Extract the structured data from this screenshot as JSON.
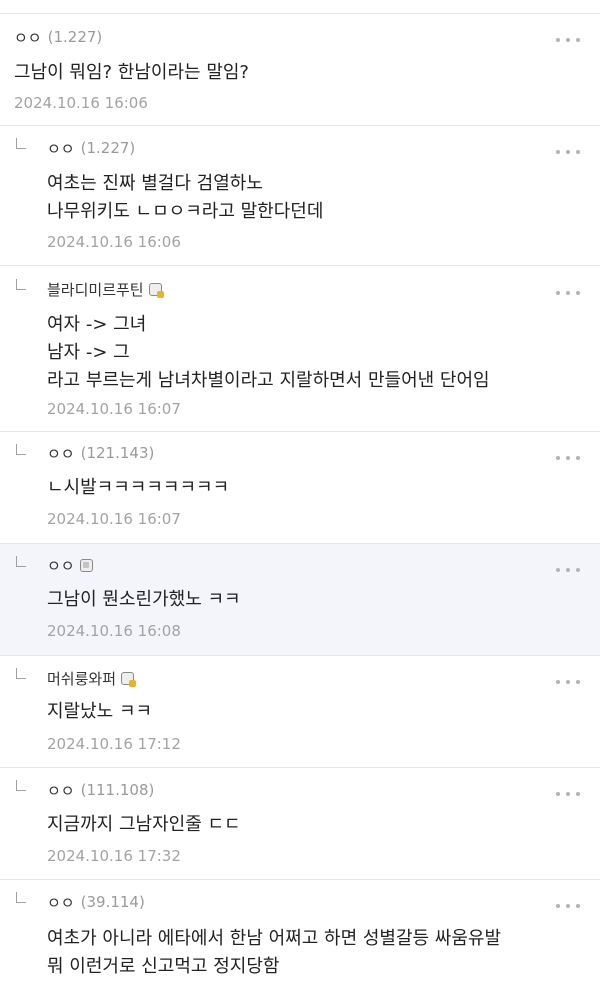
{
  "comments": [
    {
      "nick": "ㅇㅇ",
      "ip": "(1.227)",
      "lines": [
        "그남이 뭐임? 한남이라는 말임?"
      ],
      "date": "2024.10.16 16:06"
    },
    {
      "nick": "ㅇㅇ",
      "ip": "(1.227)",
      "lines": [
        "여초는 진짜 별걸다 검열하노",
        "나무위키도 ㄴㅁㅇㅋ라고 말한다던데"
      ],
      "date": "2024.10.16 16:06"
    },
    {
      "nick": "블라디미르푸틴",
      "ip": "",
      "lines": [
        "여자 -> 그녀",
        "남자 -> 그",
        "라고 부르는게 남녀차별이라고 지랄하면서 만들어낸 단어임"
      ],
      "date": "2024.10.16 16:07"
    },
    {
      "nick": "ㅇㅇ",
      "ip": "(121.143)",
      "lines": [
        "ㄴ시발ㅋㅋㅋㅋㅋㅋㅋㅋ"
      ],
      "date": "2024.10.16 16:07"
    },
    {
      "nick": "ㅇㅇ",
      "ip": "",
      "lines": [
        "그남이 뭔소린가했노 ㅋㅋ"
      ],
      "date": "2024.10.16 16:08"
    },
    {
      "nick": "머쉬룽와퍼",
      "ip": "",
      "lines": [
        "지랄났노 ㅋㅋ"
      ],
      "date": "2024.10.16 17:12"
    },
    {
      "nick": "ㅇㅇ",
      "ip": "(111.108)",
      "lines": [
        "지금까지 그남자인줄 ㄷㄷ"
      ],
      "date": "2024.10.16 17:32"
    },
    {
      "nick": "ㅇㅇ",
      "ip": "(39.114)",
      "lines": [
        "여초가 아니라 에타에서 한남 어쩌고 하면 성별갈등 싸움유발",
        "뭐 이런거로 신고먹고 정지당함"
      ],
      "date": ""
    }
  ],
  "icons": {
    "more": "more-options-icon",
    "reply": "reply-arrow-icon",
    "gallery_member": "gallery-member-icon",
    "gold_badge": "fixed-nick-badge-icon",
    "grey_badge": "semi-fixed-nick-badge-icon"
  },
  "colors": {
    "highlight_bg": "#f4f5fa",
    "divider": "#e6e6e6",
    "meta_text": "#a3a3a3"
  }
}
